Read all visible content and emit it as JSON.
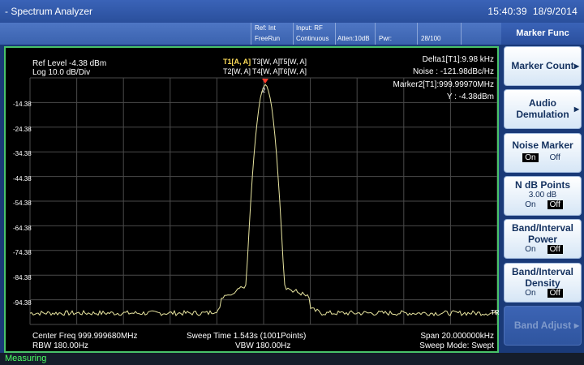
{
  "window": {
    "title": "- Spectrum Analyzer",
    "time": "15:40:39",
    "date": "18/9/2014"
  },
  "infobar": {
    "ref": "Ref: Int",
    "input": "Input: RF",
    "trigger": "FreeRun",
    "sweep": "Continuous",
    "atten": "Atten:10dB",
    "pwr": "Pwr:",
    "count": "28/100"
  },
  "plot": {
    "ref_level": "Ref Level -4.38 dBm",
    "scale": "Log 10.0 dB/Div",
    "traces_row1": [
      "T1[A, A]",
      "T3[W, A]",
      "T5[W, A]"
    ],
    "traces_row2": [
      "T2[W, A]",
      "T4[W, A]",
      "T6[W, A]"
    ],
    "delta": "Delta1[T1]:9.98 kHz",
    "noise": "Noise : -121.98dBc/Hz",
    "marker2": "Marker2[T1]:999.99970MHz",
    "marker_y": "Y : -4.38dBm",
    "marker_label": "2",
    "trace_tag": "TR",
    "y_ticks": [
      "-14.38",
      "-24.38",
      "-34.38",
      "-44.38",
      "-54.38",
      "-64.38",
      "-74.38",
      "-84.38",
      "-94.38"
    ],
    "center_freq": "Center Freq 999.999680MHz",
    "rbw": "RBW 180.00Hz",
    "sweep_time": "Sweep Time 1.543s  (1001Points)",
    "vbw": "VBW 180.00Hz",
    "span": "Span 20.000000kHz",
    "sweep_mode": "Sweep Mode: Swept",
    "trace_color": "#e8e5a0",
    "grid_color": "#4a4a4a",
    "frame_color": "#49c36a"
  },
  "status": {
    "text": "Measuring"
  },
  "softkeys": {
    "header": "Marker Func",
    "marker_count": "Marker Count",
    "audio_l1": "Audio",
    "audio_l2": "Demulation",
    "noise_marker": "Noise Marker",
    "noise_on": "On",
    "noise_off": "Off",
    "ndb": "N dB Points",
    "ndb_value": "3.00 dB",
    "ndb_on": "On",
    "ndb_off": "Off",
    "bip_l1": "Band/Interval",
    "bip_l2": "Power",
    "bip_on": "On",
    "bip_off": "Off",
    "bid_l1": "Band/Interval",
    "bid_l2": "Density",
    "bid_on": "On",
    "bid_off": "Off",
    "band_adjust": "Band Adjust",
    "arrow": "▶"
  }
}
